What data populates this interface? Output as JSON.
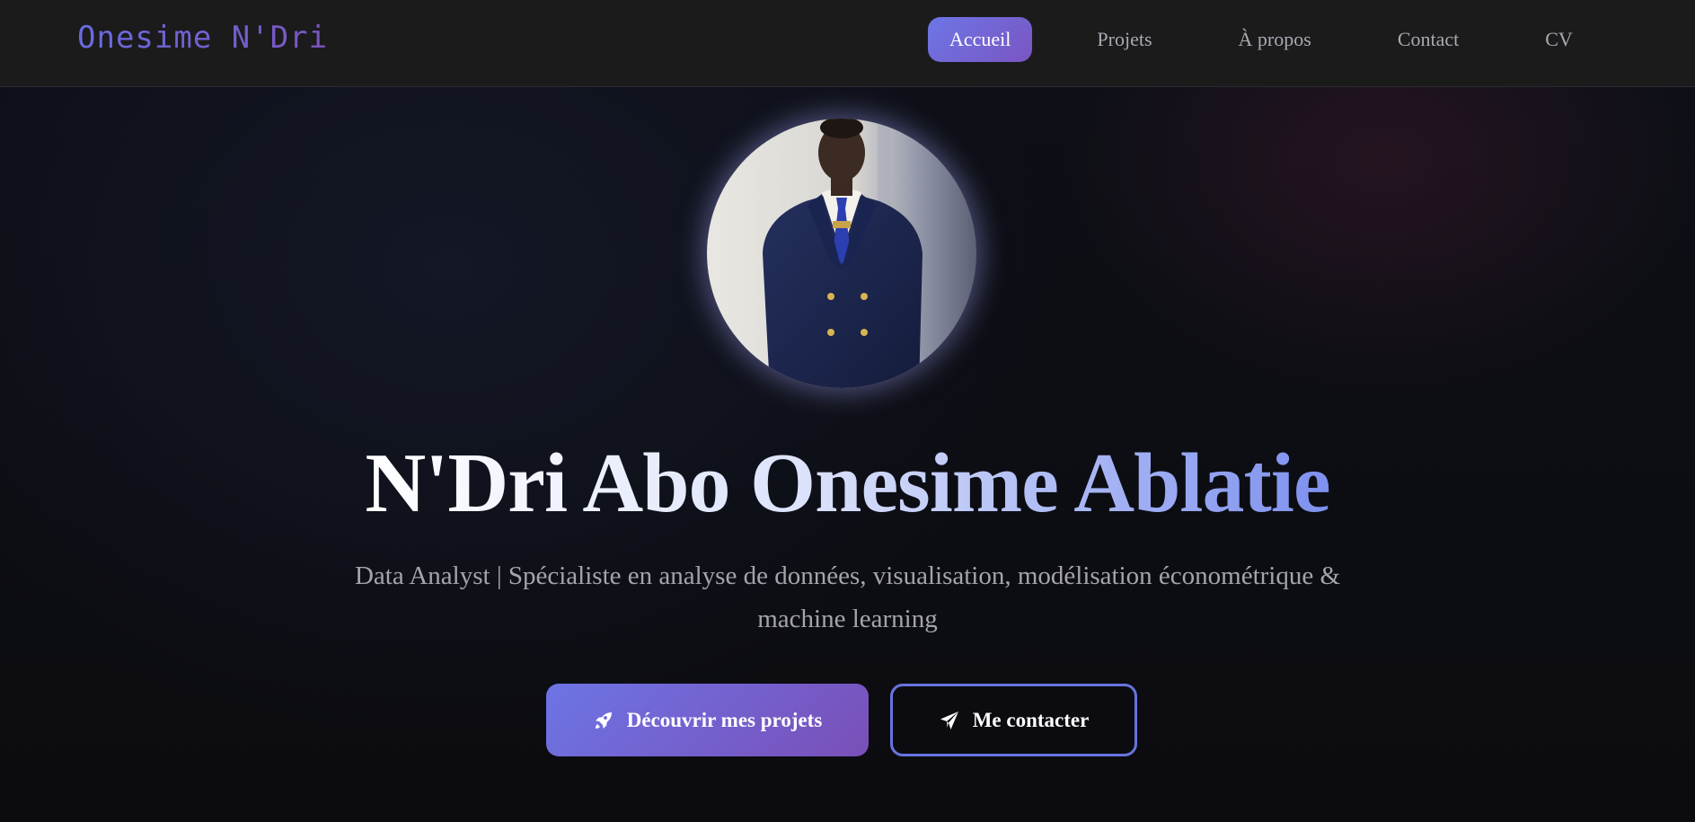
{
  "nav": {
    "brand": "Onesime N'Dri",
    "links": [
      {
        "label": "Accueil",
        "active": true
      },
      {
        "label": "Projets",
        "active": false
      },
      {
        "label": "À propos",
        "active": false
      },
      {
        "label": "Contact",
        "active": false
      },
      {
        "label": "CV",
        "active": false
      }
    ]
  },
  "hero": {
    "title": "N'Dri Abo Onesime Ablatie",
    "subtitle": "Data Analyst | Spécialiste en analyse de données, visualisation, modélisation économétrique & machine learning",
    "primary_button": {
      "label": "Découvrir mes projets",
      "icon": "rocket-icon"
    },
    "secondary_button": {
      "label": "Me contacter",
      "icon": "paper-plane-icon"
    }
  },
  "colors": {
    "accent_start": "#6d74e5",
    "accent_end": "#7a4fb8",
    "background": "#0e0e12",
    "navbar": "#1b1b1c"
  }
}
